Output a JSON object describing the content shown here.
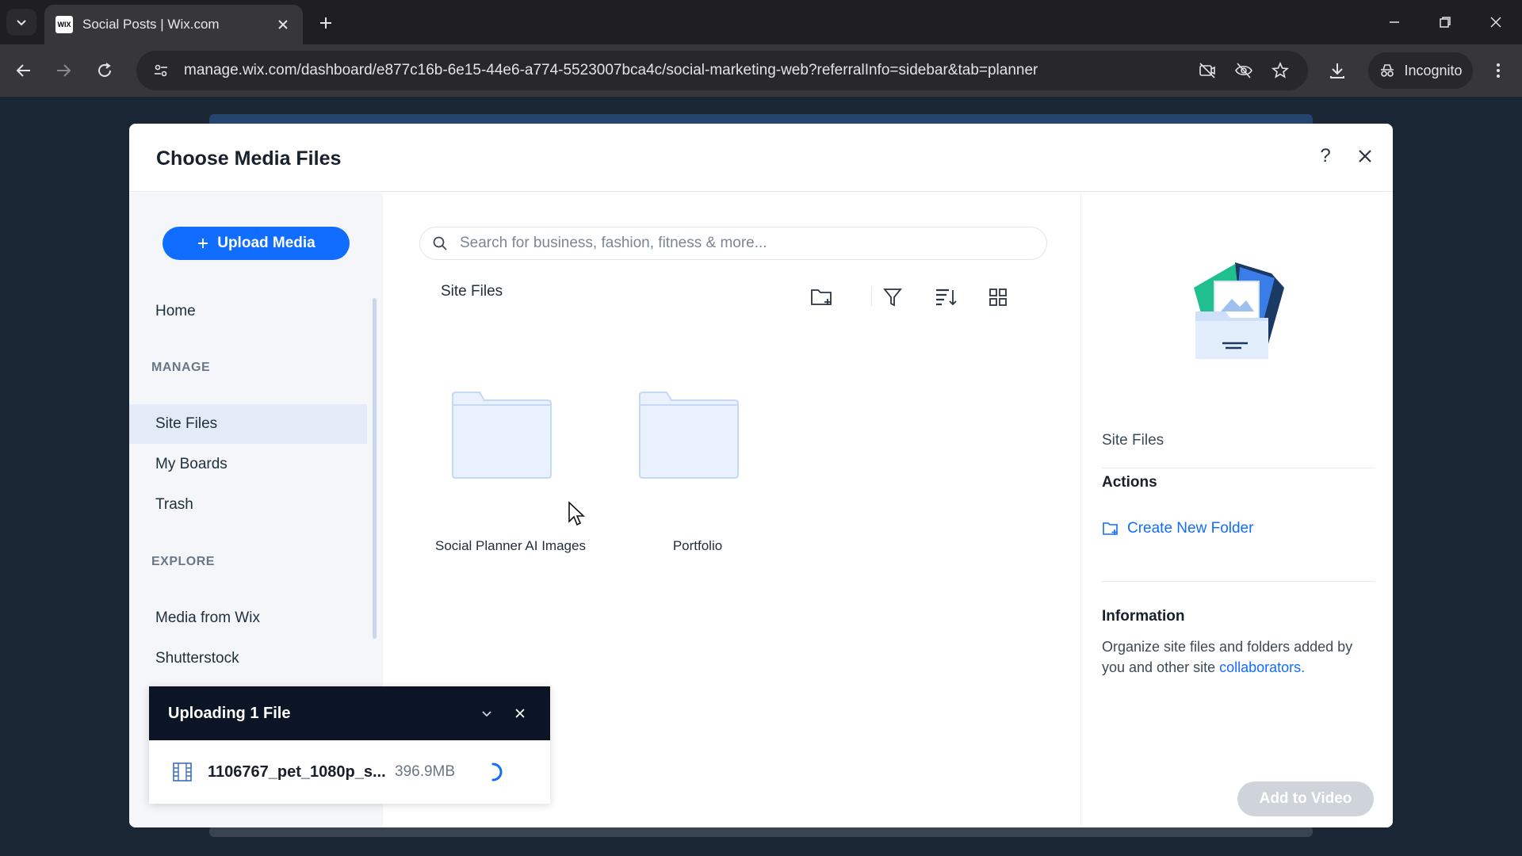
{
  "browser": {
    "tab": {
      "title": "Social Posts | Wix.com",
      "favicon": "WIX"
    },
    "url": "manage.wix.com/dashboard/e877c16b-6e15-44e6-a774-5523007bca4c/social-marketing-web?referralInfo=sidebar&tab=planner",
    "incognito_label": "Incognito"
  },
  "modal": {
    "title": "Choose Media Files",
    "help_label": "?"
  },
  "sidebar": {
    "upload_label": "Upload Media",
    "home": "Home",
    "manage_heading": "MANAGE",
    "manage_items": [
      "Site Files",
      "My Boards",
      "Trash"
    ],
    "explore_heading": "EXPLORE",
    "explore_items": [
      "Media from Wix",
      "Shutterstock"
    ],
    "active_item": "Site Files"
  },
  "main": {
    "search_placeholder": "Search for business, fashion, fitness & more...",
    "breadcrumb": "Site Files",
    "folders": [
      {
        "name": "Social Planner AI Images"
      },
      {
        "name": "Portfolio"
      }
    ]
  },
  "info": {
    "name": "Site Files",
    "actions_heading": "Actions",
    "create_folder": "Create New Folder",
    "information_heading": "Information",
    "information_text": "Organize site files and folders added by you and other site ",
    "information_link": "collaborators."
  },
  "footer": {
    "add_button": "Add to Video"
  },
  "upload_toast": {
    "title": "Uploading 1 File",
    "file_name": "1106767_pet_1080p_s...",
    "file_size": "396.9MB"
  },
  "colors": {
    "accent": "#116dff",
    "folder_fill": "#e8f1fc",
    "folder_stroke": "#c4d9f3",
    "toast_header": "#0b1526"
  }
}
